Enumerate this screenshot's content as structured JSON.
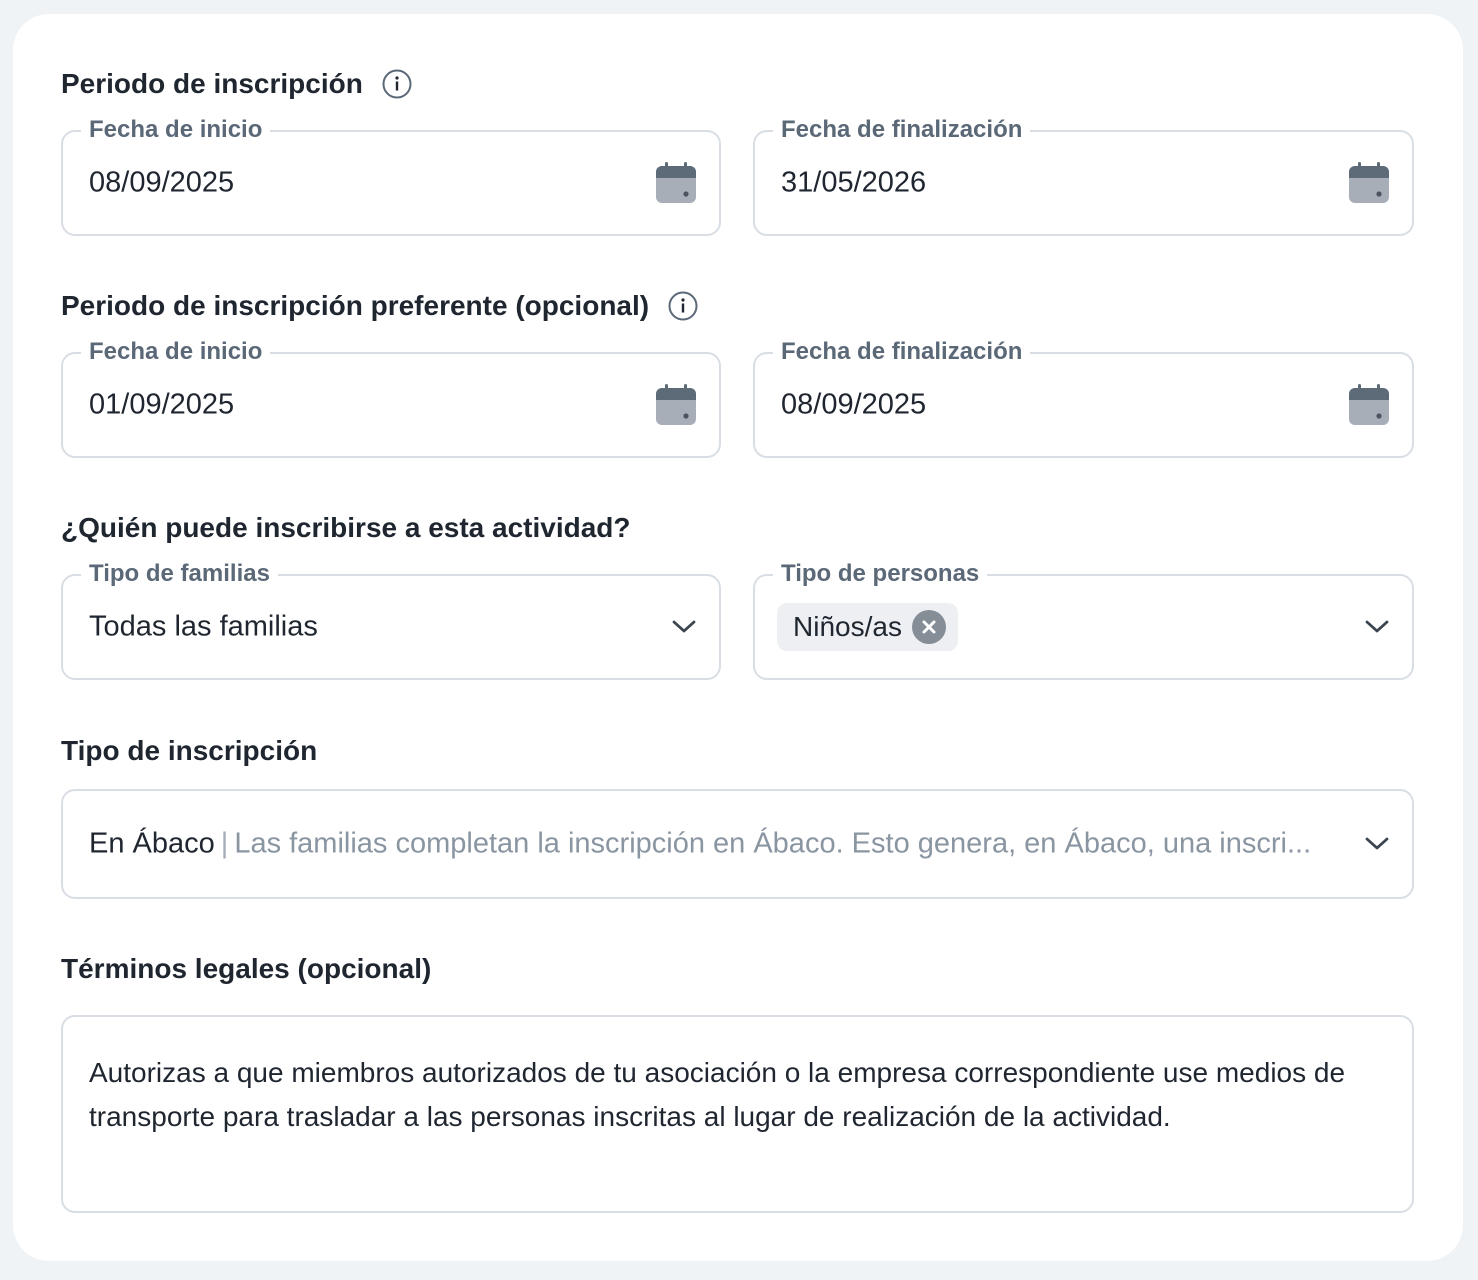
{
  "periodo": {
    "title": "Periodo de inscripción",
    "start_label": "Fecha de inicio",
    "start_value": "08/09/2025",
    "end_label": "Fecha de finalización",
    "end_value": "31/05/2026"
  },
  "preferente": {
    "title": "Periodo de inscripción preferente (opcional)",
    "start_label": "Fecha de inicio",
    "start_value": "01/09/2025",
    "end_label": "Fecha de finalización",
    "end_value": "08/09/2025"
  },
  "quien": {
    "title": "¿Quién puede inscribirse a esta actividad?",
    "familias_label": "Tipo de familias",
    "familias_value": "Todas las familias",
    "personas_label": "Tipo de personas",
    "personas_chip": "Niños/as"
  },
  "tipo_inscripcion": {
    "title": "Tipo de inscripción",
    "value": "En Ábaco",
    "separator": "|",
    "description": "Las familias completan la inscripción en Ábaco. Esto genera, en Ábaco, una inscri..."
  },
  "terminos": {
    "title": "Términos legales (opcional)",
    "text": "Autorizas a que miembros autorizados de tu asociación o la empresa correspondiente use medios de transporte para trasladar a las personas inscritas al lugar de realización de la actividad."
  },
  "icons": {
    "info": "info-icon",
    "calendar": "calendar-icon",
    "chevron": "chevron-down-icon",
    "chip_remove": "close-circle-icon"
  },
  "colors": {
    "background": "#f0f3f6",
    "card": "#ffffff",
    "border": "#d9dee4",
    "label": "#5b6877",
    "text": "#1f2630",
    "icon": "#6b7682"
  }
}
